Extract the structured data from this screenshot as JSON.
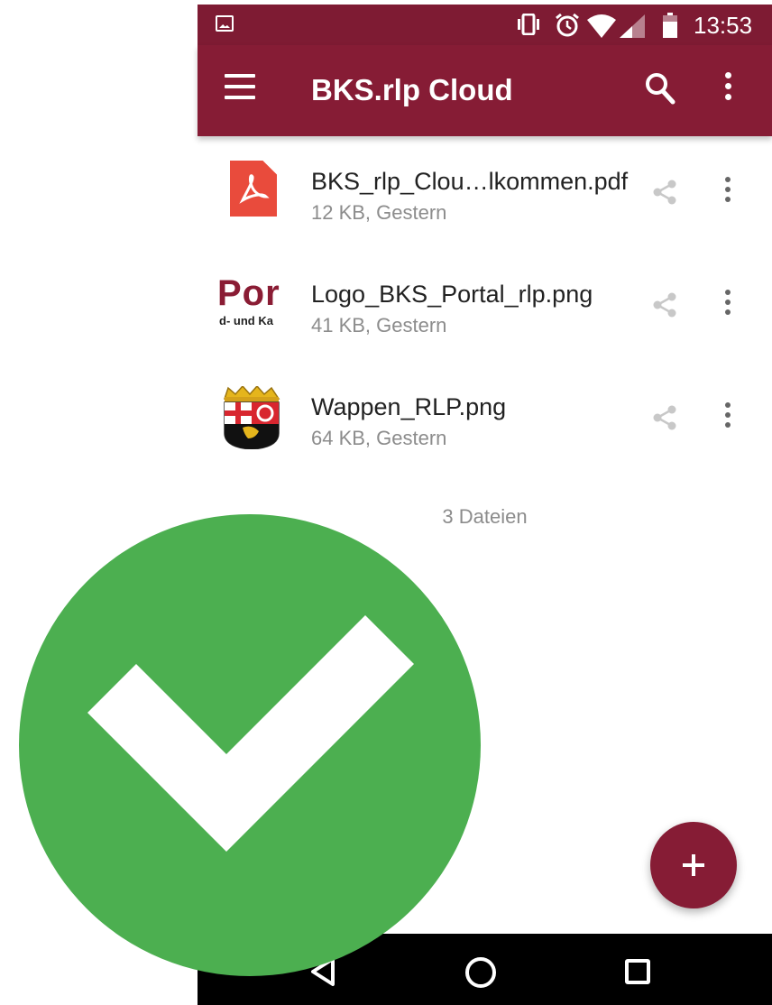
{
  "status_bar": {
    "time": "13:53",
    "icons": [
      "gallery-icon",
      "vibrate-icon",
      "alarm-icon",
      "wifi-icon",
      "signal-icon",
      "battery-icon"
    ]
  },
  "app_bar": {
    "title": "BKS.rlp Cloud",
    "icons": [
      "menu-icon",
      "search-icon",
      "more-vert-icon"
    ]
  },
  "files": [
    {
      "name": "BKS_rlp_Clou…lkommen.pdf",
      "meta": "12 KB, Gestern",
      "thumb": "pdf-icon"
    },
    {
      "name": "Logo_BKS_Portal_rlp.png",
      "meta": "41 KB, Gestern",
      "thumb": "logo-thumbnail",
      "thumb_text": [
        "Por",
        "d- und Ka"
      ]
    },
    {
      "name": "Wappen_RLP.png",
      "meta": "64 KB, Gestern",
      "thumb": "coat-of-arms-thumbnail"
    }
  ],
  "files_count": "3 Dateien",
  "fab": {
    "icon": "plus-icon"
  },
  "nav": {
    "icons": [
      "back-icon",
      "home-icon",
      "recents-icon"
    ]
  },
  "overlay": {
    "icon": "checkmark-badge-icon"
  },
  "colors": {
    "app_bar": "#861c35",
    "status_bar": "#7e1b33",
    "fab": "#861c35",
    "check_badge": "#4caf50",
    "pdf": "#e94b3c",
    "secondary_text": "#8c8c8c"
  }
}
